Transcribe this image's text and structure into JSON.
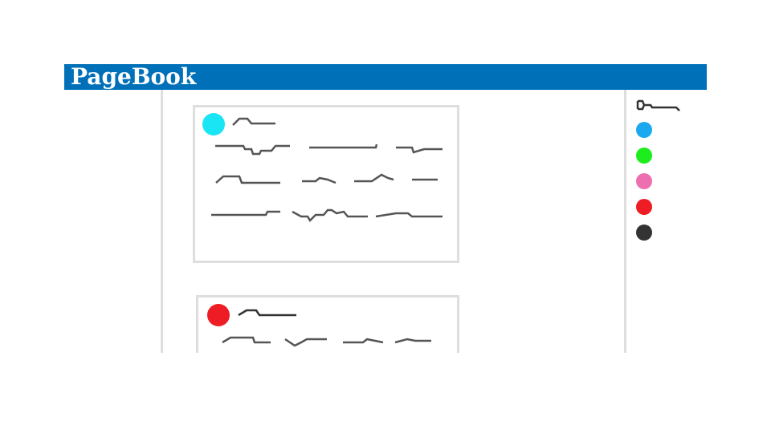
{
  "app": {
    "title": "PageBook"
  },
  "posts": [
    {
      "avatar_color": "#19e5f5"
    },
    {
      "avatar_color": "#ee1c24"
    }
  ],
  "sidebar": {
    "filters": [
      {
        "color": "#1aa9ef"
      },
      {
        "color": "#1ded1d"
      },
      {
        "color": "#ee6fb0"
      },
      {
        "color": "#ee1c24"
      },
      {
        "color": "#333333"
      }
    ]
  },
  "colors": {
    "header_bg": "#0070b8",
    "border": "#dedede",
    "scribble": "#555555"
  }
}
